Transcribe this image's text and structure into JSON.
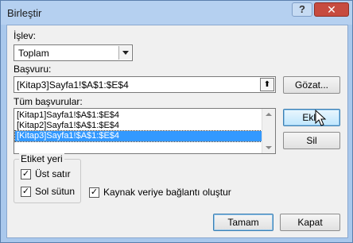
{
  "window": {
    "title": "Birleştir"
  },
  "titlebar": {
    "help": "?",
    "close": "✕"
  },
  "function": {
    "label": "İşlev:",
    "selected": "Toplam"
  },
  "reference": {
    "label": "Başvuru:",
    "value": "[Kitap3]Sayfa1!$A$1:$E$4",
    "browse_label": "Gözat..."
  },
  "all_references": {
    "label": "Tüm başvurular:",
    "items": [
      {
        "text": "[Kitap1]Sayfa1!$A$1:$E$4"
      },
      {
        "text": "[Kitap2]Sayfa1!$A$1:$E$4"
      },
      {
        "text": "[Kitap3]Sayfa1!$A$1:$E$4"
      }
    ],
    "selected_index": 2,
    "add_label": "Ekle",
    "delete_label": "Sil"
  },
  "labels_group": {
    "title": "Etiket yeri",
    "top_row": {
      "label": "Üst satır",
      "checked": true
    },
    "left_column": {
      "label": "Sol sütun",
      "checked": true
    }
  },
  "create_links": {
    "label": "Kaynak veriye bağlantı oluştur",
    "checked": true
  },
  "footer": {
    "ok_label": "Tamam",
    "close_label": "Kapat"
  }
}
